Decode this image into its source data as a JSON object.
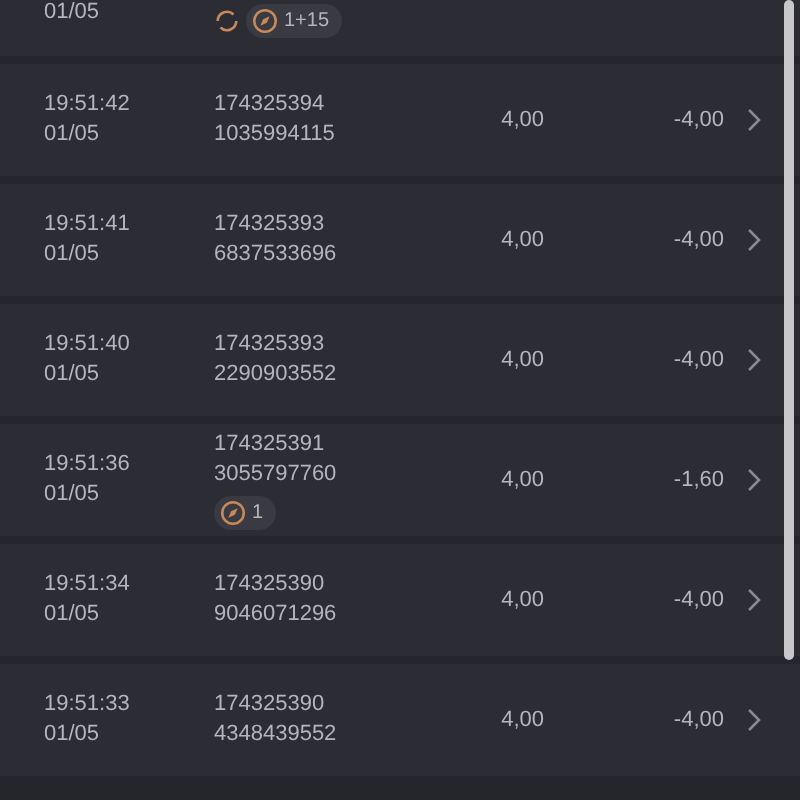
{
  "rows": [
    {
      "date": "01/05",
      "recurring": true,
      "badge": "1+15"
    },
    {
      "time": "19:51:42",
      "date": "01/05",
      "order": "174325394",
      "ticket": "1035994115",
      "quantity": "4,00",
      "amount": "-4,00",
      "recurring": false
    },
    {
      "time": "19:51:41",
      "date": "01/05",
      "order": "174325393",
      "ticket": "6837533696",
      "quantity": "4,00",
      "amount": "-4,00",
      "recurring": false
    },
    {
      "time": "19:51:40",
      "date": "01/05",
      "order": "174325393",
      "ticket": "2290903552",
      "quantity": "4,00",
      "amount": "-4,00",
      "recurring": false
    },
    {
      "time": "19:51:36",
      "date": "01/05",
      "order": "174325391",
      "ticket": "3055797760",
      "quantity": "4,00",
      "amount": "-1,60",
      "recurring": false,
      "badge": "1"
    },
    {
      "time": "19:51:34",
      "date": "01/05",
      "order": "174325390",
      "ticket": "9046071296",
      "quantity": "4,00",
      "amount": "-4,00",
      "recurring": false
    },
    {
      "time": "19:51:33",
      "date": "01/05",
      "order": "174325390",
      "ticket": "4348439552",
      "quantity": "4,00",
      "amount": "-4,00",
      "recurring": false
    }
  ]
}
